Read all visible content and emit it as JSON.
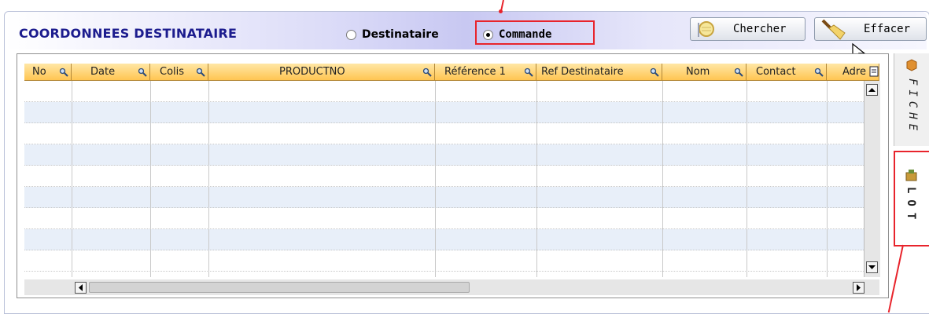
{
  "header": {
    "title": "COORDONNEES DESTINATAIRE",
    "radio_destinataire": "Destinataire",
    "radio_commande": "Commande",
    "selected": "Commande",
    "search_button": "Chercher",
    "clear_button": "Effacer"
  },
  "grid": {
    "columns": [
      {
        "label": "No"
      },
      {
        "label": "Date"
      },
      {
        "label": "Colis"
      },
      {
        "label": "PRODUCTNO"
      },
      {
        "label": "Référence 1"
      },
      {
        "label": "Ref Destinataire"
      },
      {
        "label": "Nom"
      },
      {
        "label": "Contact"
      },
      {
        "label": "Adre"
      }
    ],
    "row_count": 9
  },
  "side_tabs": {
    "fiche": "FICHE",
    "lot": "LOT",
    "active": "LOT"
  },
  "colors": {
    "title": "#1c1c8e",
    "header_orange": "#ffc552",
    "row_alt": "#e8eff9",
    "highlight_red": "#e8242c"
  },
  "icons": [
    "search-icon",
    "radio-icon",
    "magnifier-icon",
    "broom-icon",
    "table-options-icon",
    "scroll-up-icon",
    "scroll-down-icon",
    "scroll-left-icon",
    "scroll-right-icon",
    "fiche-icon",
    "lot-icon",
    "mouse-cursor-icon"
  ]
}
